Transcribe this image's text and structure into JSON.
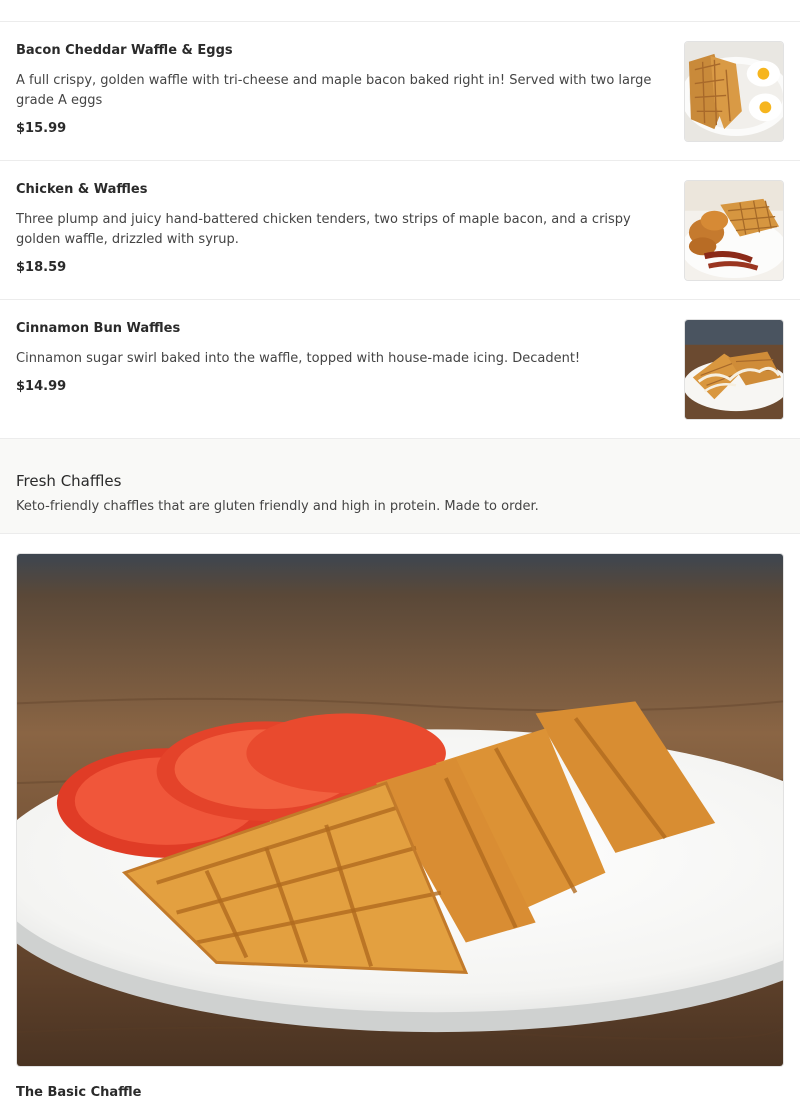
{
  "menu_items": [
    {
      "name": "Bacon Cheddar Waffle & Eggs",
      "description": "A full crispy, golden waffle with tri-cheese and maple bacon baked right in! Served with two large grade A eggs",
      "price": "$15.99",
      "image": "waffle-and-eggs-photo"
    },
    {
      "name": "Chicken & Waffles",
      "description": "Three plump and juicy hand-battered chicken tenders, two strips of maple bacon, and a crispy golden waffle, drizzled with syrup.",
      "price": "$18.59",
      "image": "chicken-and-waffles-photo"
    },
    {
      "name": "Cinnamon Bun Waffles",
      "description": "Cinnamon sugar swirl baked into the waffle, topped with house-made icing. Decadent!",
      "price": "$14.99",
      "image": "cinnamon-bun-waffles-photo"
    }
  ],
  "section": {
    "title": "Fresh Chaffles",
    "description": "Keto-friendly chaffles that are gluten friendly and high in protein. Made to order."
  },
  "featured_item": {
    "name": "The Basic Chaffle",
    "image": "chaffle-with-tomato-photo"
  },
  "colors": {
    "divider": "#ececec",
    "section_bg": "#f9f9f7",
    "text": "#2d2d2d"
  }
}
